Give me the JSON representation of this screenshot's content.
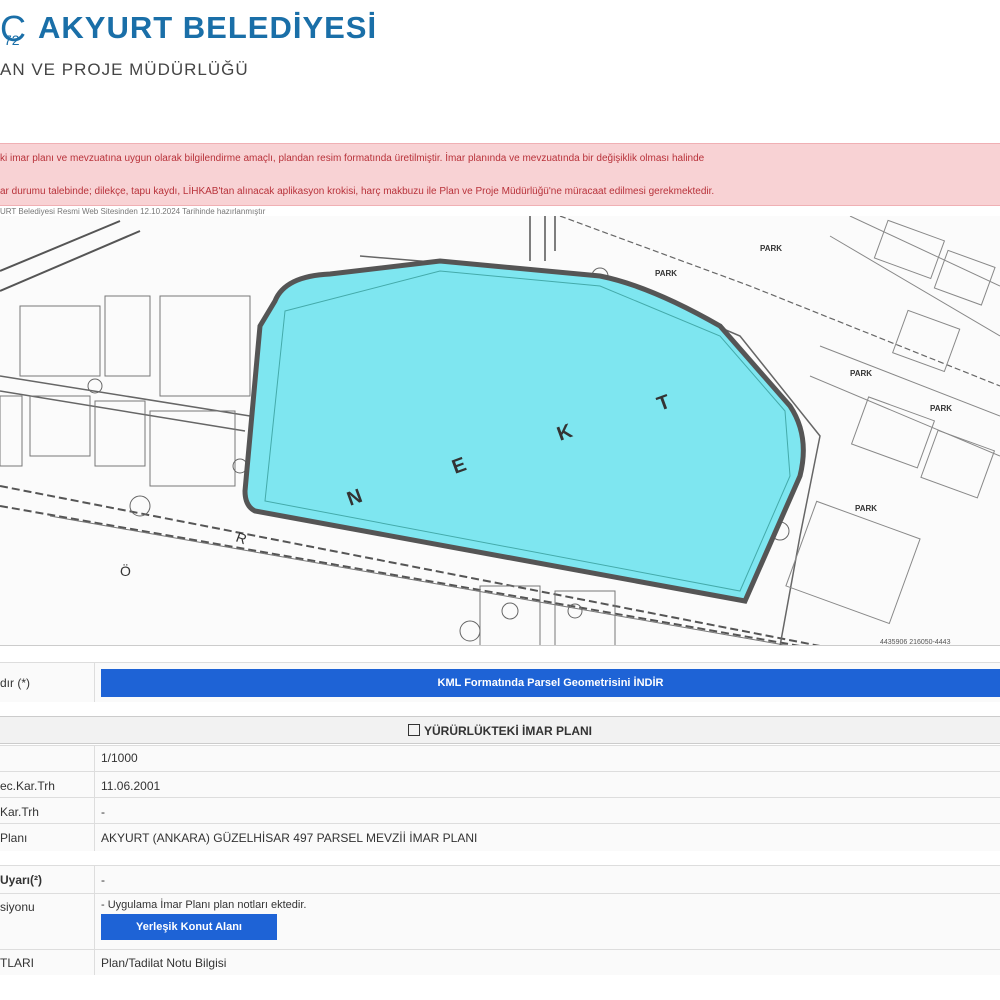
{
  "header": {
    "logo_mark": "C",
    "logo_sub": "72",
    "org_title": "AKYURT BELEDİYESİ",
    "dept_title": "AN VE PROJE MÜDÜRLÜĞÜ"
  },
  "warning": {
    "line1": "ki imar planı ve mevzuatına uygun olarak bilgilendirme amaçlı, plandan resim formatında üretilmiştir. İmar planında ve mevzuatında bir değişiklik olması halinde",
    "line2": "ar durumu talebinde; dilekçe, tapu kaydı, LİHKAB'tan alınacak aplikasyon krokisi, harç makbuzu ile Plan ve Proje Müdürlüğü'ne müracaat edilmesi gerekmektedir."
  },
  "map": {
    "caption": "URT Belediyesi Resmi Web Sitesinden 12.10.2024 Tarihinde hazırlanmıştır",
    "letters": [
      "N",
      "E",
      "K",
      "T"
    ],
    "park_labels": [
      "PARK",
      "PARK",
      "PARK",
      "PARK",
      "PARK"
    ],
    "corner_letters": [
      "R",
      "Ö"
    ],
    "coord_text": "4435906 216050-4443"
  },
  "kml_row": {
    "label": "dır (*)",
    "button_label": "KML Formatında Parsel Geometrisini İNDİR"
  },
  "section": {
    "title": "YÜRÜRLÜKTEKİ İMAR PLANI"
  },
  "plan_rows": [
    {
      "label": "",
      "value": "1/1000"
    },
    {
      "label": "ec.Kar.Trh",
      "value": "11.06.2001"
    },
    {
      "label": "Kar.Trh",
      "value": "-"
    },
    {
      "label": "Planı",
      "value": "AKYURT (ANKARA) GÜZELHİSAR 497 PARSEL MEVZİİ İMAR PLANI"
    }
  ],
  "uyari_row": {
    "label": "Uyarı(²)",
    "value": "-"
  },
  "fonksiyon_row": {
    "label": "siyonu",
    "note": "- Uygulama İmar Planı plan notları ektedir.",
    "button_label": "Yerleşik Konut Alanı"
  },
  "notlar_row": {
    "label": "TLARI",
    "link": "Plan/Tadilat Notu Bilgisi"
  },
  "colors": {
    "brand": "#1a6fa8",
    "button": "#1e63d6",
    "warning_bg": "#f8d2d4",
    "warning_text": "#b8323a",
    "parcel_fill": "#7ee6f0"
  }
}
